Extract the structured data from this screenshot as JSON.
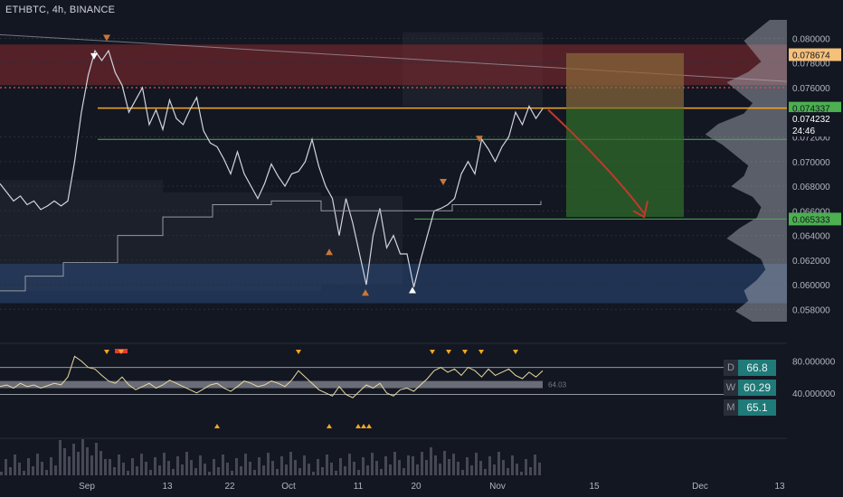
{
  "header": {
    "symbol_label": "ETHBTC, 4h, BINANCE"
  },
  "colors": {
    "background": "#131722",
    "price_line": "#d1d4dc",
    "supply_zone": "#8b2a2e",
    "demand_zone": "#2b4a7a",
    "orange_level": "#f5a623",
    "green_level": "#4caf50",
    "rsi_line": "#e8d9a0",
    "rsi_low": "#6fd1c0",
    "target_box": "#2f6b2a",
    "stop_box": "#8a6a3a",
    "arrow": "#c0392b",
    "label_green": "#4caf50",
    "label_orange": "#f5c07a",
    "panel_teal": "#1f7a78"
  },
  "price_labels": [
    {
      "text": "0.078674",
      "style": "orange"
    },
    {
      "text": "0.074337",
      "style": "green"
    },
    {
      "text": "0.074232",
      "style": "dark"
    },
    {
      "text": "24:46",
      "style": "dark"
    },
    {
      "text": "0.065333",
      "style": "green"
    }
  ],
  "rsi_labels": [
    {
      "text": "80.000000"
    },
    {
      "text": "40.000000"
    }
  ],
  "rsi_value_label": "64.03",
  "mtf_panel": [
    {
      "key": "D",
      "value": "66.8"
    },
    {
      "key": "W",
      "value": "60.29"
    },
    {
      "key": "M",
      "value": "65.1"
    }
  ],
  "chart_data": {
    "type": "line",
    "title": "ETHBTC, 4h, BINANCE",
    "y_axis": {
      "range": [
        0.057,
        0.0815
      ],
      "ticks": [
        "0.080000",
        "0.078000",
        "0.076000",
        "0.072000",
        "0.070000",
        "0.068000",
        "0.066000",
        "0.064000",
        "0.062000",
        "0.060000",
        "0.058000"
      ]
    },
    "x_axis": {
      "ticks": [
        "Sep",
        "13",
        "22",
        "Oct",
        "11",
        "20",
        "Nov",
        "15",
        "Dec",
        "13"
      ]
    },
    "series": [
      {
        "values": [
          0.0682,
          0.0675,
          0.0668,
          0.0672,
          0.0665,
          0.0668,
          0.0661,
          0.0664,
          0.0668,
          0.0664,
          0.0668,
          0.07,
          0.074,
          0.077,
          0.079,
          0.0782,
          0.079,
          0.0772,
          0.0762,
          0.074,
          0.075,
          0.076,
          0.073,
          0.0742,
          0.0726,
          0.075,
          0.0735,
          0.073,
          0.0742,
          0.0752,
          0.0725,
          0.0715,
          0.0712,
          0.0702,
          0.069,
          0.0708,
          0.069,
          0.068,
          0.067,
          0.0682,
          0.0698,
          0.0688,
          0.068,
          0.069,
          0.0692,
          0.07,
          0.0718,
          0.0696,
          0.068,
          0.067,
          0.064,
          0.067,
          0.065,
          0.0625,
          0.06,
          0.064,
          0.0662,
          0.063,
          0.064,
          0.0625,
          0.0625,
          0.0598,
          0.062,
          0.064,
          0.066,
          0.0662,
          0.0665,
          0.067,
          0.069,
          0.07,
          0.069,
          0.0718,
          0.071,
          0.07,
          0.0712,
          0.072,
          0.074,
          0.073,
          0.0745,
          0.0735,
          0.0743
        ]
      }
    ],
    "levels": [
      {
        "value": 0.076,
        "style": "dotted-red"
      },
      {
        "value": 0.074337,
        "style": "orange"
      },
      {
        "value": 0.0718,
        "style": "green"
      },
      {
        "value": 0.065333,
        "style": "green"
      }
    ],
    "zones": [
      {
        "from": 0.0762,
        "to": 0.0795,
        "kind": "supply"
      },
      {
        "from": 0.0585,
        "to": 0.0617,
        "kind": "demand"
      }
    ],
    "trade_box": {
      "entry": 0.0743,
      "stop": 0.0788,
      "target": 0.0655
    },
    "rsi": {
      "range": [
        0,
        100
      ],
      "ticks": [
        80,
        40
      ],
      "bands": [
        72,
        38
      ],
      "values": [
        48,
        50,
        46,
        52,
        48,
        50,
        46,
        49,
        52,
        50,
        60,
        86,
        80,
        72,
        70,
        62,
        55,
        52,
        60,
        50,
        44,
        48,
        52,
        46,
        50,
        56,
        52,
        48,
        44,
        40,
        45,
        50,
        52,
        46,
        42,
        48,
        55,
        52,
        48,
        50,
        55,
        52,
        48,
        56,
        68,
        60,
        52,
        44,
        40,
        36,
        48,
        38,
        34,
        42,
        50,
        46,
        52,
        40,
        36,
        44,
        46,
        42,
        50,
        58,
        68,
        72,
        66,
        70,
        62,
        72,
        68,
        60,
        70,
        62,
        66,
        70,
        62,
        58,
        66,
        60,
        68
      ]
    }
  }
}
